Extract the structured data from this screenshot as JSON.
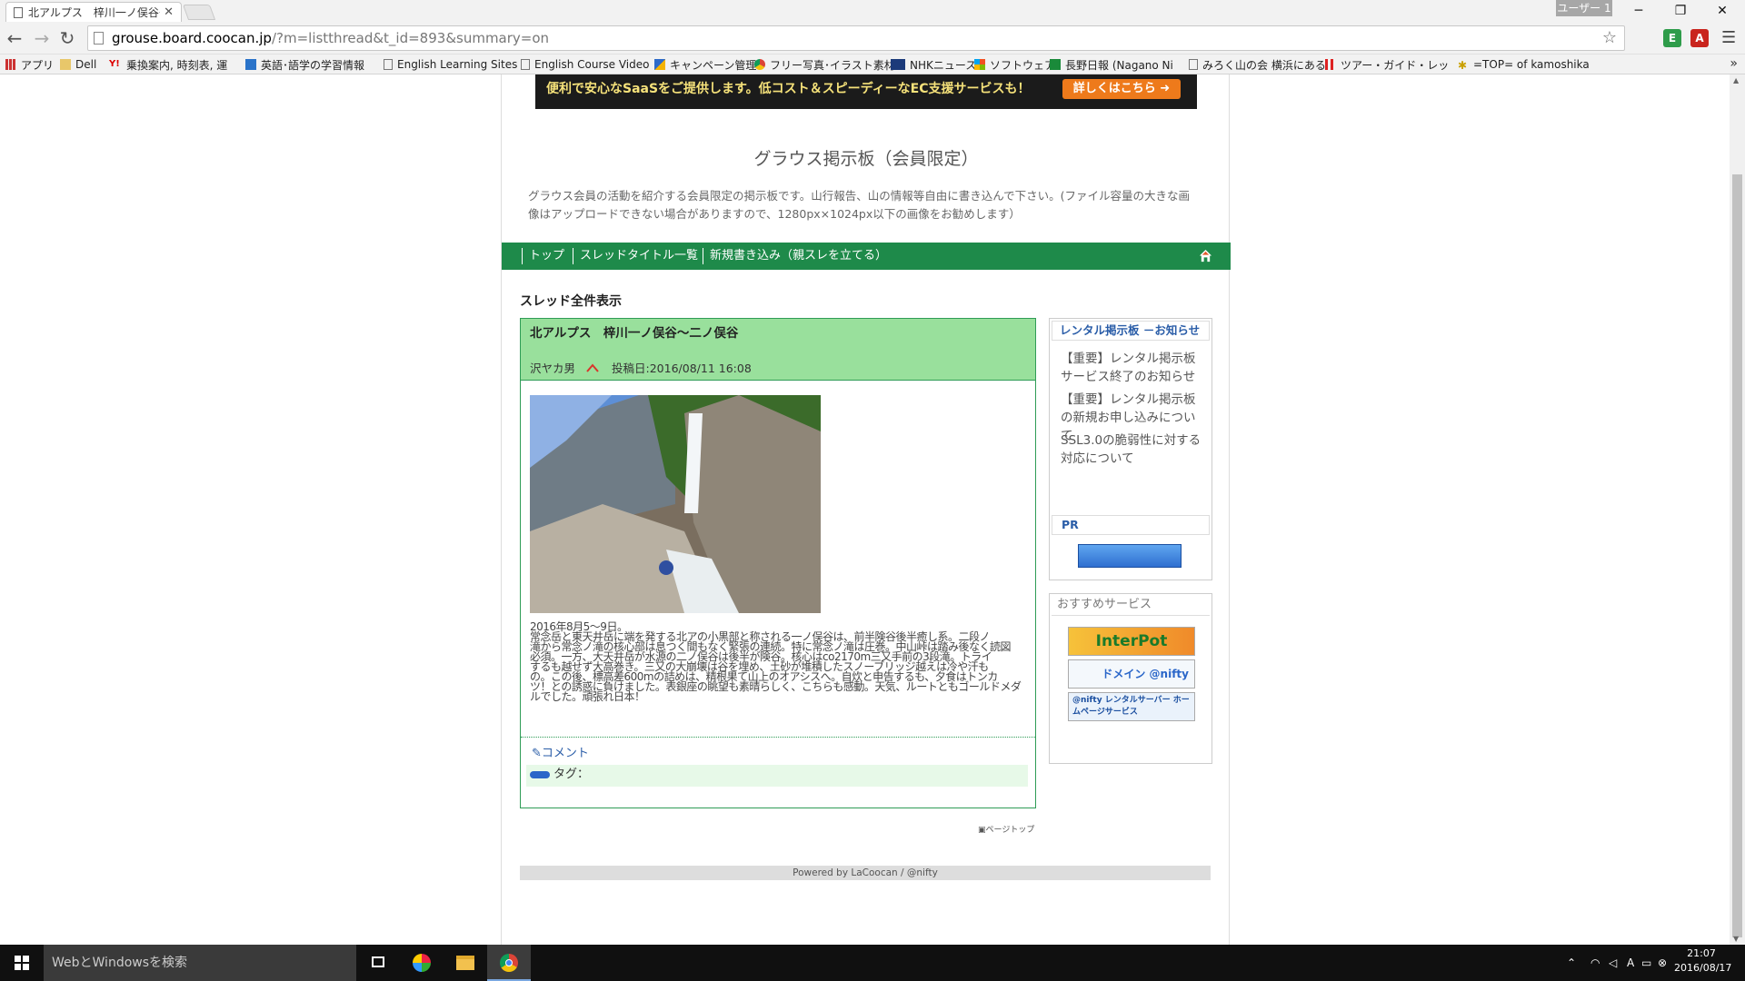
{
  "browser": {
    "tab_title": "北アルプス　梓川一ノ俣谷〜",
    "user_label": "ユーザー 1",
    "url_host": "grouse.board.coocan.jp",
    "url_path": "/?m=listthread&t_id=893&summary=on",
    "window_buttons": [
      "minimize",
      "restore",
      "close"
    ]
  },
  "bookmarks": [
    {
      "label": "アプリ",
      "icon": "apps-grid-icon"
    },
    {
      "label": "Dell",
      "icon": "folder-icon"
    },
    {
      "label": "乗換案内, 時刻表, 運",
      "icon": "yahoo-icon"
    },
    {
      "label": "英語･語学の学習情報",
      "icon": "learn-icon"
    },
    {
      "label": "English Learning Sites",
      "icon": "page-icon"
    },
    {
      "label": "English Course Video",
      "icon": "page-icon"
    },
    {
      "label": "キャンペーン管理",
      "icon": "adwords-icon"
    },
    {
      "label": "フリー写真･イラスト素材",
      "icon": "chrome-icon"
    },
    {
      "label": "NHKニュース",
      "icon": "nhk-icon"
    },
    {
      "label": "ソフトウェア",
      "icon": "windows-icon"
    },
    {
      "label": "長野日報 (Nagano Ni",
      "icon": "leaf-icon"
    },
    {
      "label": "みろく山の会 横浜にある",
      "icon": "page-icon"
    },
    {
      "label": "ツアー・ガイド・レッスン - ",
      "icon": "red-bars-icon"
    },
    {
      "label": "=TOP= of kamoshika",
      "icon": "bird-icon"
    }
  ],
  "banner": {
    "text": "便利で安心なSaaSをご提供します。低コスト＆スピーディーなEC支援サービスも！",
    "button": "詳しくはこちら ➜"
  },
  "board": {
    "title": "グラウス掲示板（会員限定）",
    "description": "グラウス会員の活動を紹介する会員限定の掲示板です。山行報告、山の情報等自由に書き込んで下さい。(ファイル容量の大きな画像はアップロードできない場合がありますので、1280px×1024px以下の画像をお勧めします）"
  },
  "nav": {
    "top": "トップ",
    "thread_list": "スレッドタイトル一覧",
    "new_post": "新規書き込み（親スレを立てる）"
  },
  "section_title": "スレッド全件表示",
  "post": {
    "title": "北アルプス　梓川一ノ俣谷〜二ノ俣谷",
    "author": "沢ヤカ男",
    "posted": "投稿日:2016/08/11 16:08",
    "body_lines": [
      "2016年8月5〜9日。",
      "常念岳と東天井岳に端を発する北アの小黒部と称される一ノ俣谷は、前半険谷後半癒し系。二段ノ",
      "滝から常念ノ滝の核心部は息つく間もなく緊張の連続。特に常念ノ滝は圧巻。中山峠は踏み後なく読図",
      "必須。一方、大天井岳が水源の二ノ俣谷は後半が険谷。核心はco2170m三又手前の3段滝。トライ",
      "するも越せず大高巻き。三又の大崩壊は谷を埋め、土砂が堆積したスノーブリッジ越えは冷や汗も",
      "の。この後、標高差600mの詰めは、精根果て山上のオアシスへ。自炊と申告するも、夕食はトンカ",
      "ツ！との誘惑に負けました。表銀座の眺望も素晴らしく、こちらも感動。天気、ルートともゴールドメダ",
      "ルでした。頑張れ日本！"
    ],
    "comment_label": "コメント",
    "tag_label": "タグ："
  },
  "page_top": "ページトップ",
  "footer": "Powered by LaCoocan / @nifty",
  "sidebar": {
    "notice_title": "レンタル掲示板 －お知らせ",
    "notices": [
      "【重要】レンタル掲示板サービス終了のお知らせ",
      "【重要】レンタル掲示板の新規お申し込みについて",
      "SSL3.0の脆弱性に対する対応について"
    ],
    "pr_title": "PR",
    "services_title": "おすすめサービス",
    "services": [
      "InterPot",
      "ドメイン @nifty",
      "@nifty レンタルサーバー ホームページサービス"
    ]
  },
  "taskbar": {
    "search_placeholder": "WebとWindowsを検索",
    "time": "21:07",
    "date": "2016/08/17"
  },
  "colors": {
    "nav_green": "#1e8a4a",
    "post_header": "#99e09c",
    "link_blue": "#2a5da8"
  }
}
